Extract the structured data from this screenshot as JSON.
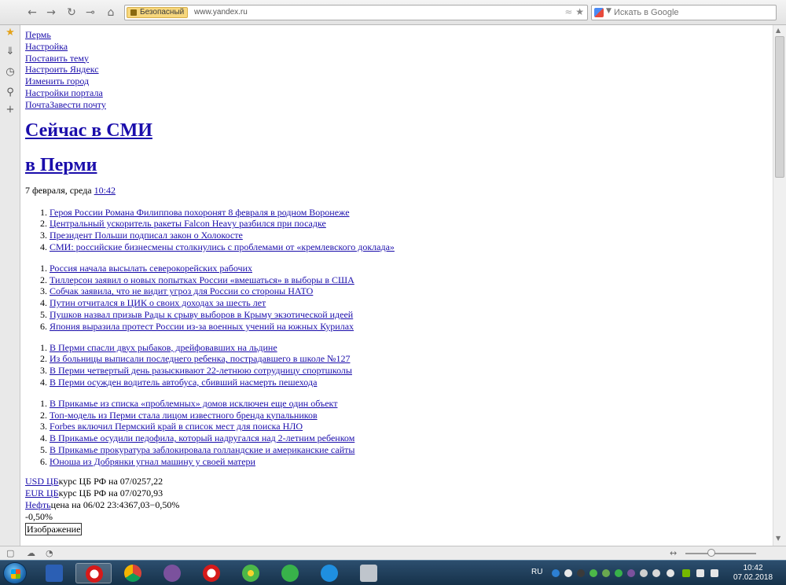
{
  "browser": {
    "security_label": "Безопасный",
    "url": "www.yandex.ru",
    "search_placeholder": "Искать в Google"
  },
  "page": {
    "top_links": [
      "Пермь",
      "Настройка",
      "Поставить тему",
      "Настроить Яндекс",
      "Изменить город",
      "Настройки портала",
      "ПочтаЗавести почту"
    ],
    "heading_main": "Сейчас в СМИ",
    "heading_city": "в Перми",
    "date_text": "7 февраля, среда ",
    "time_link": "10:42",
    "news_groups": [
      [
        "Героя России Романа Филиппова похоронят 8 февраля в родном Воронеже",
        "Центральный ускоритель ракеты Falcon Heavy разбился при посадке",
        "Президент Польши подписал закон о Холокосте",
        "СМИ: российские бизнесмены столкнулись с проблемами от «кремлевского доклада»"
      ],
      [
        "Россия начала высылать северокорейских рабочих",
        "Тиллерсон заявил о новых попытках России «вмешаться» в выборы в США",
        "Собчак заявила, что не видит угроз для России со стороны НАТО",
        "Путин отчитался в ЦИК о своих доходах за шесть лет",
        "Пушков назвал призыв Рады к срыву выборов в Крыму экзотической идеей",
        "Япония выразила протест России из-за военных учений на южных Курилах"
      ],
      [
        "В Перми спасли двух рыбаков, дрейфовавших на льдине",
        "Из больницы выписали последнего ребенка, пострадавшего в школе №127",
        "В Перми четвертый день разыскивают 22-летнюю сотрудницу спортшколы",
        "В Перми осужден водитель автобуса, сбивший насмерть пешехода"
      ],
      [
        "В Прикамье из списка «проблемных» домов исключен еще один объект",
        "Топ-модель из Перми стала лицом известного бренда купальников",
        "Forbes включил Пермский край в список мест для поиска НЛО",
        "В Прикамье осудили педофила, который надругался над 2-летним ребенком",
        "В Прикамье прокуратура заблокировала голландские и американские сайты",
        "Юноша из Добрянки угнал машину у своей матери"
      ]
    ],
    "rates": {
      "usd_link": "USD ЦБ",
      "usd_text": "курс ЦБ РФ на 07/0257,22",
      "eur_link": "EUR ЦБ",
      "eur_text": "курс ЦБ РФ на 07/0270,93",
      "oil_link": "Нефть",
      "oil_text": "цена на 06/02 23:4367,03−0,50%",
      "oil_change": "-0,50%"
    },
    "image_label": "Изображение"
  },
  "taskbar": {
    "language": "RU",
    "time": "10:42",
    "date": "07.02.2018"
  }
}
